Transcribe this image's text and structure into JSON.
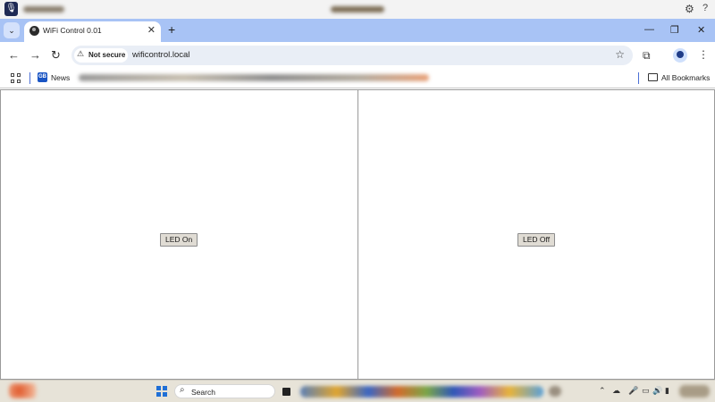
{
  "browser": {
    "tab": {
      "title": "WiFi Control 0.01"
    },
    "address": {
      "security_label": "Not secure",
      "url": "wificontrol.local"
    },
    "bookmarks": {
      "news_label": "News",
      "all_label": "All Bookmarks"
    }
  },
  "page": {
    "left_button": "LED On",
    "right_button": "LED Off"
  },
  "taskbar": {
    "search_label": "Search"
  },
  "icons": {
    "mic": "🎙",
    "gear": "⚙",
    "help": "?",
    "tab_search": "⌄",
    "tab_close": "✕",
    "new_tab": "+",
    "minimize": "—",
    "restore": "❐",
    "close": "✕",
    "back": "←",
    "forward": "→",
    "reload": "↻",
    "warning": "⚠",
    "star": "☆",
    "extensions": "⧉",
    "kebab": "⋮",
    "search": "⌕",
    "tray_up": "⌃",
    "cloud": "☁",
    "mic_tray": "🎤",
    "display": "▭",
    "volume": "🔊",
    "battery": "▮"
  },
  "colors": {
    "tabstrip": "#a8c3f5",
    "omnibox": "#e9eef6",
    "button_face": "#e0dcd4",
    "taskbar": "#e7e3d8"
  }
}
